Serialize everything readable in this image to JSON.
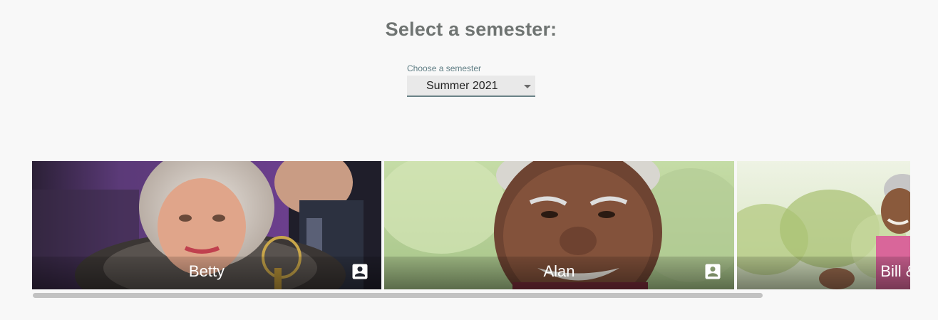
{
  "header": {
    "title": "Select a semester:"
  },
  "semester_select": {
    "label": "Choose a semester",
    "selected": "Summer 2021"
  },
  "cards": [
    {
      "name": "Betty",
      "icon": "account-box-icon"
    },
    {
      "name": "Alan",
      "icon": "account-box-icon"
    },
    {
      "name": "Bill & Wa",
      "icon": "account-box-icon"
    }
  ],
  "colors": {
    "page_background": "#f8f8f8",
    "title": "#6f7472",
    "select_label": "#5f7d84",
    "select_underline": "#6a8287",
    "scrollbar_thumb": "#c2c2c2"
  }
}
